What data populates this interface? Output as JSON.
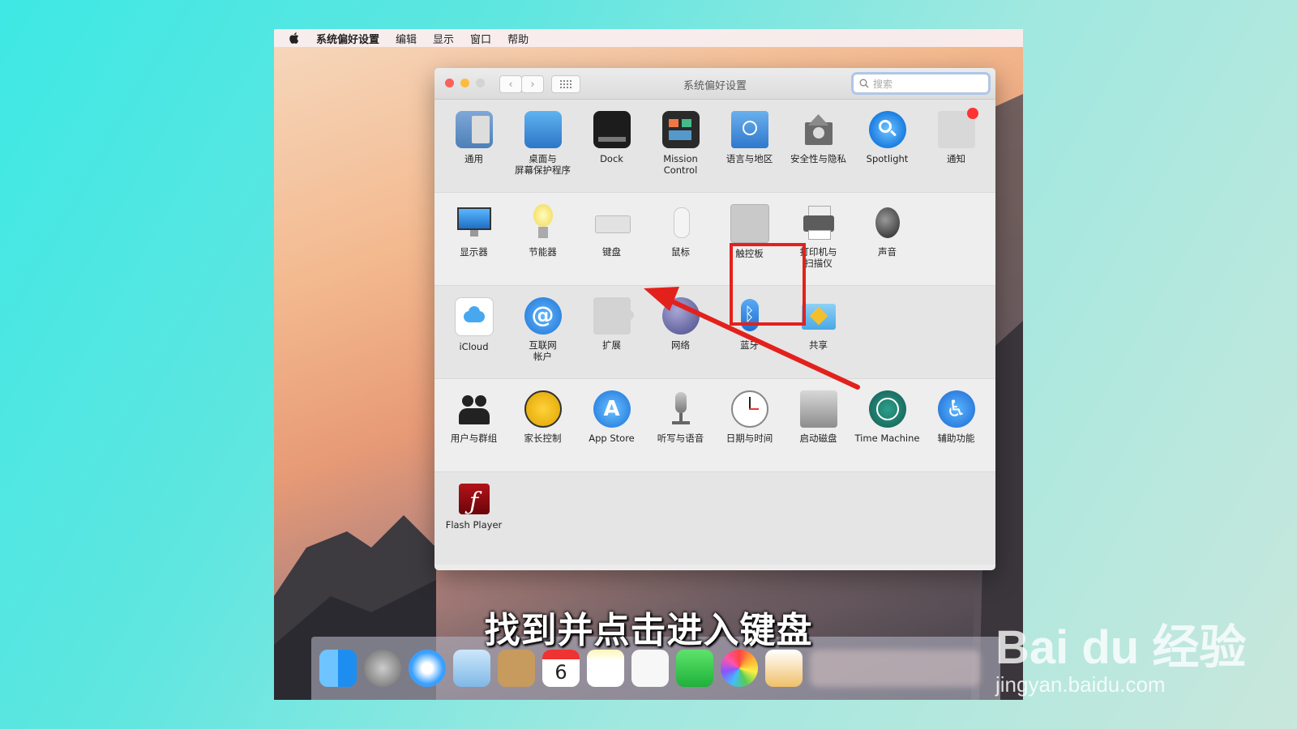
{
  "menubar": {
    "items": [
      "系统偏好设置",
      "编辑",
      "显示",
      "窗口",
      "帮助"
    ]
  },
  "window": {
    "title": "系统偏好设置",
    "search_placeholder": "搜索"
  },
  "prefs": {
    "row1": [
      {
        "label": "通用",
        "icon": "general-icon"
      },
      {
        "label": "桌面与\n屏幕保护程序",
        "icon": "desktop-icon"
      },
      {
        "label": "Dock",
        "icon": "dock-icon"
      },
      {
        "label": "Mission\nControl",
        "icon": "mission-control-icon"
      },
      {
        "label": "语言与地区",
        "icon": "language-icon"
      },
      {
        "label": "安全性与隐私",
        "icon": "security-icon"
      },
      {
        "label": "Spotlight",
        "icon": "spotlight-icon"
      },
      {
        "label": "通知",
        "icon": "notifications-icon"
      }
    ],
    "row2": [
      {
        "label": "显示器",
        "icon": "display-icon"
      },
      {
        "label": "节能器",
        "icon": "energy-saver-icon"
      },
      {
        "label": "键盘",
        "icon": "keyboard-icon"
      },
      {
        "label": "鼠标",
        "icon": "mouse-icon"
      },
      {
        "label": "触控板",
        "icon": "trackpad-icon"
      },
      {
        "label": "打印机与\n扫描仪",
        "icon": "printer-icon"
      },
      {
        "label": "声音",
        "icon": "sound-icon"
      }
    ],
    "row3": [
      {
        "label": "iCloud",
        "icon": "icloud-icon"
      },
      {
        "label": "互联网\n帐户",
        "icon": "internet-accounts-icon"
      },
      {
        "label": "扩展",
        "icon": "extensions-icon"
      },
      {
        "label": "网络",
        "icon": "network-icon"
      },
      {
        "label": "蓝牙",
        "icon": "bluetooth-icon"
      },
      {
        "label": "共享",
        "icon": "sharing-icon"
      }
    ],
    "row4": [
      {
        "label": "用户与群组",
        "icon": "users-icon"
      },
      {
        "label": "家长控制",
        "icon": "parental-controls-icon"
      },
      {
        "label": "App Store",
        "icon": "app-store-icon"
      },
      {
        "label": "听写与语音",
        "icon": "dictation-icon"
      },
      {
        "label": "日期与时间",
        "icon": "date-time-icon"
      },
      {
        "label": "启动磁盘",
        "icon": "startup-disk-icon"
      },
      {
        "label": "Time Machine",
        "icon": "time-machine-icon"
      },
      {
        "label": "辅助功能",
        "icon": "accessibility-icon"
      }
    ],
    "row5": [
      {
        "label": "Flash Player",
        "icon": "flash-player-icon"
      }
    ]
  },
  "dock": {
    "calendar_day": "6",
    "items": [
      "finder-icon",
      "launchpad-icon",
      "safari-icon",
      "mail-icon",
      "contacts-icon",
      "calendar-icon",
      "notes-icon",
      "reminders-icon",
      "facetime-icon",
      "photos-icon",
      "pages-icon"
    ]
  },
  "overlay": {
    "caption": "找到并点击进入键盘",
    "watermark_brand": "Bai du 经验",
    "watermark_url": "jingyan.baidu.com",
    "highlight_color": "#e3211c"
  }
}
